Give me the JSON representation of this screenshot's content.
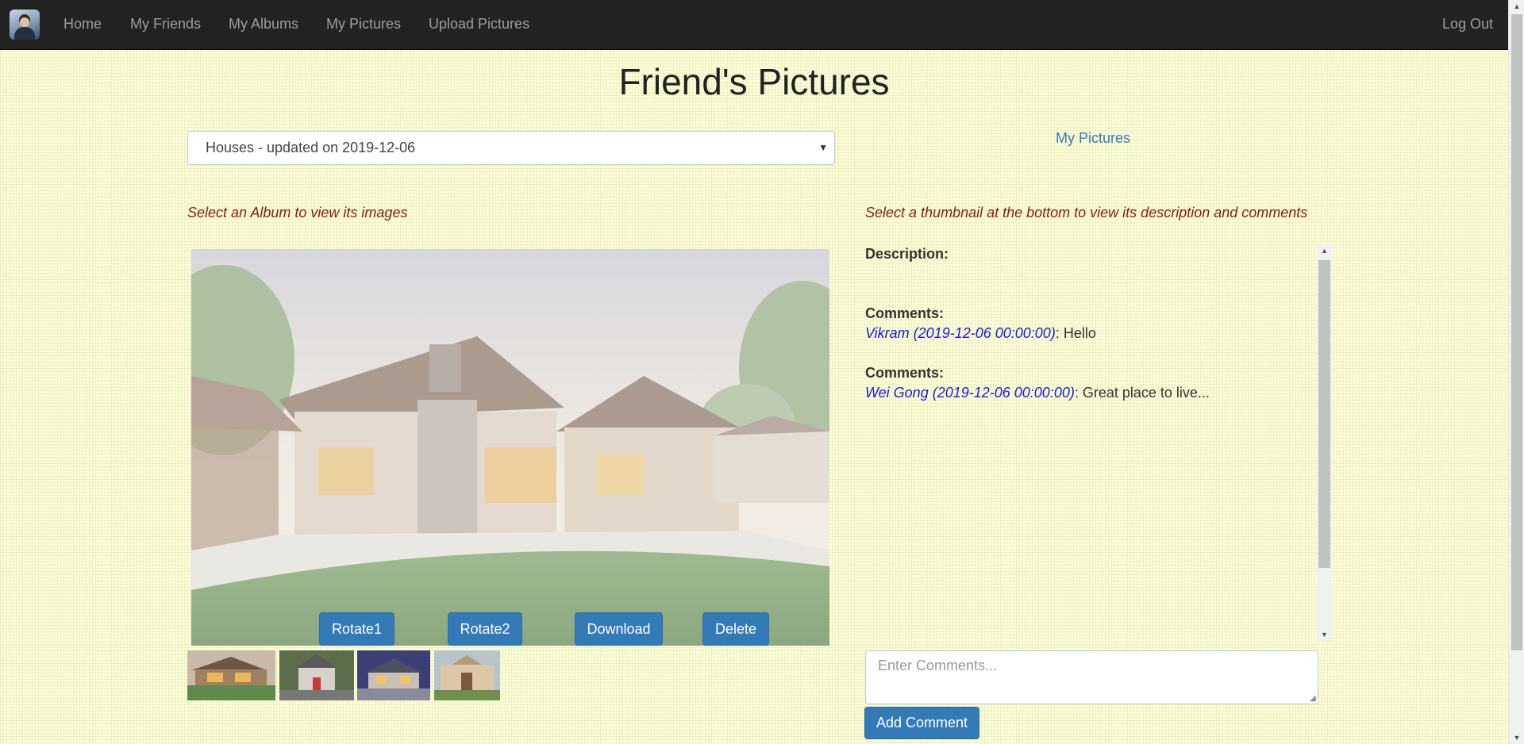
{
  "nav": {
    "items": [
      {
        "label": "Home"
      },
      {
        "label": "My Friends"
      },
      {
        "label": "My Albums"
      },
      {
        "label": "My Pictures"
      },
      {
        "label": "Upload Pictures"
      }
    ],
    "logout": "Log Out"
  },
  "page_title": "Friend's Pictures",
  "album_select": {
    "selected": "Houses - updated on 2019-12-06"
  },
  "my_pictures_link": "My Pictures",
  "hints": {
    "album": "Select an Album to view its images",
    "thumbnail": "Select a thumbnail at the bottom to view its description and comments"
  },
  "image_buttons": {
    "rotate1": "Rotate1",
    "rotate2": "Rotate2",
    "download": "Download",
    "delete": "Delete"
  },
  "details": {
    "description_label": "Description:",
    "description_text": "",
    "comments": [
      {
        "label": "Comments:",
        "author": "Vikram (2019-12-06 00:00:00)",
        "text": ": Hello"
      },
      {
        "label": "Comments:",
        "author": "Wei Gong (2019-12-06 00:00:00)",
        "text": ": Great place to live..."
      }
    ]
  },
  "comment_input": {
    "placeholder": "Enter Comments..."
  },
  "add_comment_label": "Add Comment",
  "colors": {
    "navbar": "#222222",
    "nav_text": "#9d9d9d",
    "primary_button": "#337ab7",
    "hint_text": "#8b1a1a",
    "comment_author": "#1a1adb",
    "background": "#fdfdd8"
  },
  "icons": {
    "select_caret": "caret-down-icon",
    "brand": "user-avatar-logo"
  }
}
